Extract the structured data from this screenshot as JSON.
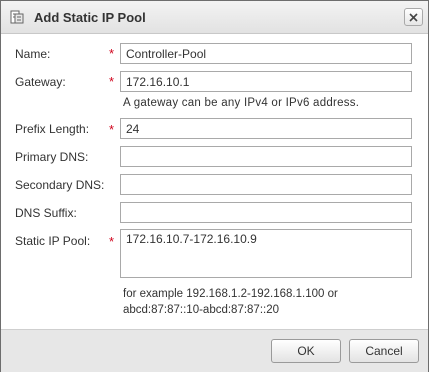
{
  "dialog": {
    "title": "Add Static IP Pool",
    "title_icon": "ip-pool-icon",
    "close_icon": "close-icon"
  },
  "required_marker": "*",
  "fields": {
    "name": {
      "label": "Name:",
      "value": "Controller-Pool",
      "required": true
    },
    "gateway": {
      "label": "Gateway:",
      "value": "172.16.10.1",
      "required": true,
      "hint": "A gateway can be any IPv4 or IPv6 address."
    },
    "prefix_length": {
      "label": "Prefix Length:",
      "value": "24",
      "required": true
    },
    "primary_dns": {
      "label": "Primary DNS:",
      "value": "",
      "required": false
    },
    "secondary_dns": {
      "label": "Secondary DNS:",
      "value": "",
      "required": false
    },
    "dns_suffix": {
      "label": "DNS Suffix:",
      "value": "",
      "required": false
    },
    "static_ip_pool": {
      "label": "Static IP Pool:",
      "value": "172.16.10.7-172.16.10.9",
      "required": true,
      "hint_line1": "for example 192.168.1.2-192.168.1.100 or",
      "hint_line2": "abcd:87:87::10-abcd:87:87::20"
    }
  },
  "buttons": {
    "ok": "OK",
    "cancel": "Cancel"
  }
}
